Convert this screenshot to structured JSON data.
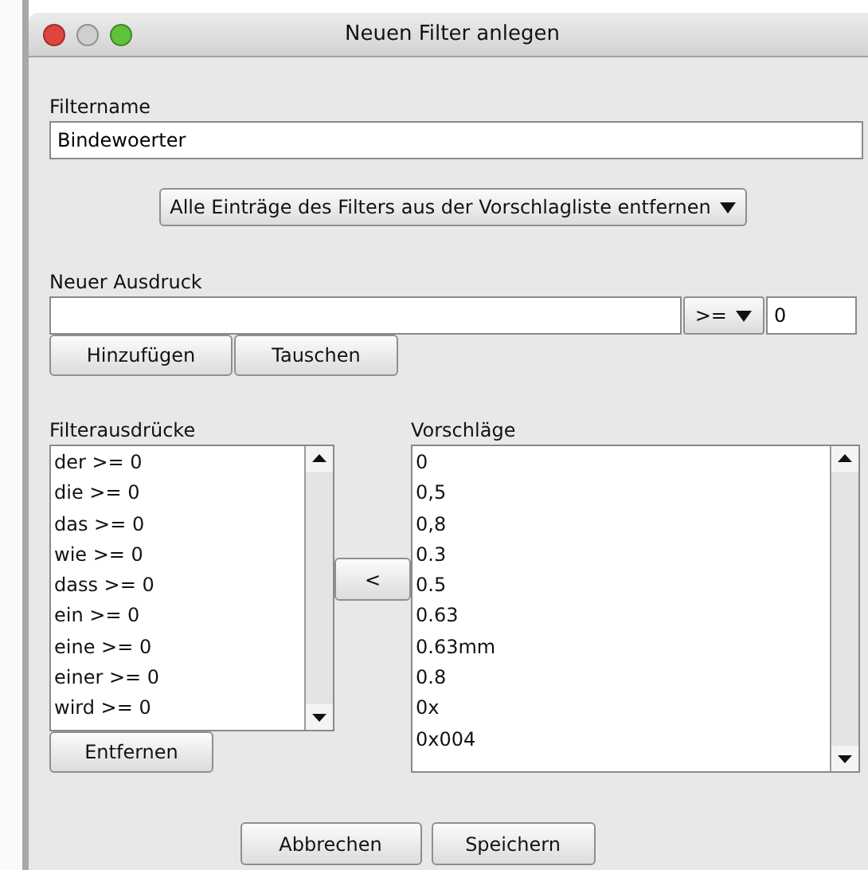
{
  "window": {
    "title": "Neuen Filter anlegen"
  },
  "filter_name": {
    "label": "Filtername",
    "value": "Bindewoerter"
  },
  "remove_all_dropdown": {
    "label": "Alle Einträge des Filters aus der Vorschlagliste entfernen"
  },
  "new_expression": {
    "label": "Neuer Ausdruck",
    "operator": ">=",
    "threshold": "0"
  },
  "expression_buttons": [
    "Hinzufügen",
    "Tauschen"
  ],
  "filter_expressions": {
    "label": "Filterausdrücke",
    "items": [
      "der >= 0",
      "die >= 0",
      "das >= 0",
      "wie >= 0",
      "dass >= 0",
      "ein >= 0",
      "eine >= 0",
      "einer >= 0",
      "wird >= 0"
    ],
    "remove_button": "Entfernen"
  },
  "move_button": "<",
  "suggestions": {
    "label": "Vorschläge",
    "items": [
      "0",
      "0,5",
      "0,8",
      "0.3",
      "0.5",
      "0.63",
      "0.63mm",
      "0.8",
      "0x",
      "0x004"
    ]
  },
  "buttons": [
    "Abbrechen",
    "Speichern"
  ]
}
